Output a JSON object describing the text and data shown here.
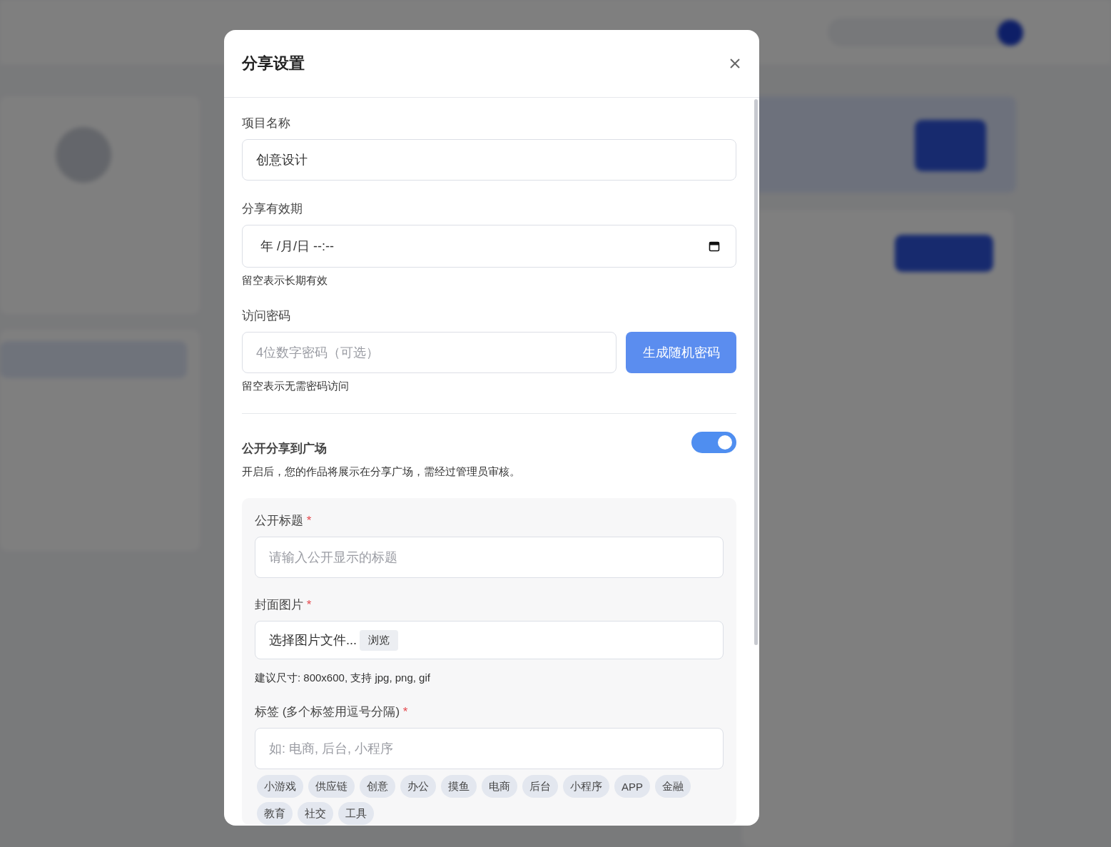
{
  "dialog": {
    "title": "分享设置",
    "project_name": {
      "label": "项目名称",
      "value": "创意设计"
    },
    "expiry": {
      "label": "分享有效期",
      "placeholder": "年 /月/日  --:--",
      "hint": "留空表示长期有效"
    },
    "password": {
      "label": "访问密码",
      "placeholder": "4位数字密码（可选）",
      "button": "生成随机密码",
      "hint": "留空表示无需密码访问"
    },
    "public_share": {
      "label": "公开分享到广场",
      "on": true,
      "description": "开启后，您的作品将展示在分享广场，需经过管理员审核。"
    },
    "public_form": {
      "title_field": {
        "label": "公开标题",
        "required_mark": "*",
        "placeholder": "请输入公开显示的标题"
      },
      "cover": {
        "label": "封面图片",
        "required_mark": "*",
        "file_text": "选择图片文件...",
        "browse_button": "浏览",
        "hint": "建议尺寸: 800x600, 支持 jpg, png, gif"
      },
      "tags_field": {
        "label": "标签 (多个标签用逗号分隔)",
        "required_mark": "*",
        "placeholder": "如: 电商, 后台, 小程序",
        "suggestions": [
          "小游戏",
          "供应链",
          "创意",
          "办公",
          "摸鱼",
          "电商",
          "后台",
          "小程序",
          "APP",
          "金融",
          "教育",
          "社交",
          "工具"
        ]
      }
    }
  }
}
